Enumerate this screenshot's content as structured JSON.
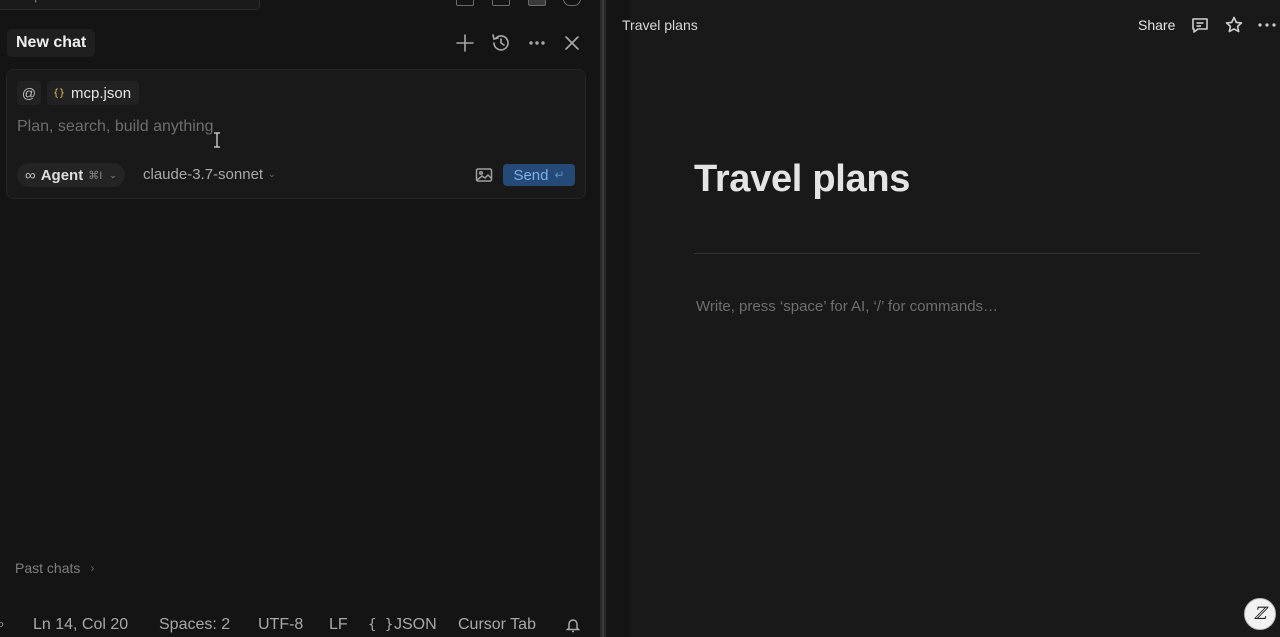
{
  "top_strip": {
    "search_text": "en-mcp-server"
  },
  "chat": {
    "tab_label": "New chat",
    "header_icons": [
      "plus-icon",
      "history-icon",
      "more-icon",
      "close-icon"
    ],
    "composer": {
      "at_symbol": "@",
      "file_chip": {
        "icon": "{}",
        "name": "mcp.json"
      },
      "placeholder": "Plan, search, build anything",
      "mode": {
        "icon": "∞",
        "label": "Agent",
        "shortcut": "⌘I"
      },
      "model": "claude-3.7-sonnet",
      "send_label": "Send",
      "send_shortcut": "↵"
    },
    "past_chats_label": "Past chats"
  },
  "status_bar": {
    "position": "Ln 14, Col 20",
    "indent": "Spaces: 2",
    "encoding": "UTF-8",
    "line_ending": "LF",
    "language_icon": "{ }",
    "language": "JSON",
    "cursor_tab": "Cursor Tab"
  },
  "notes": {
    "breadcrumb": "Travel plans",
    "share_label": "Share",
    "title": "Travel plans",
    "placeholder": "Write, press ‘space’ for AI, ‘/’ for commands…",
    "ai_button_glyph": "ℤ"
  },
  "colors": {
    "background": "#141414",
    "notes_background": "#191919",
    "send_button": "#254a78",
    "send_text": "#7fb0ea",
    "file_icon": "#e3c35a"
  }
}
